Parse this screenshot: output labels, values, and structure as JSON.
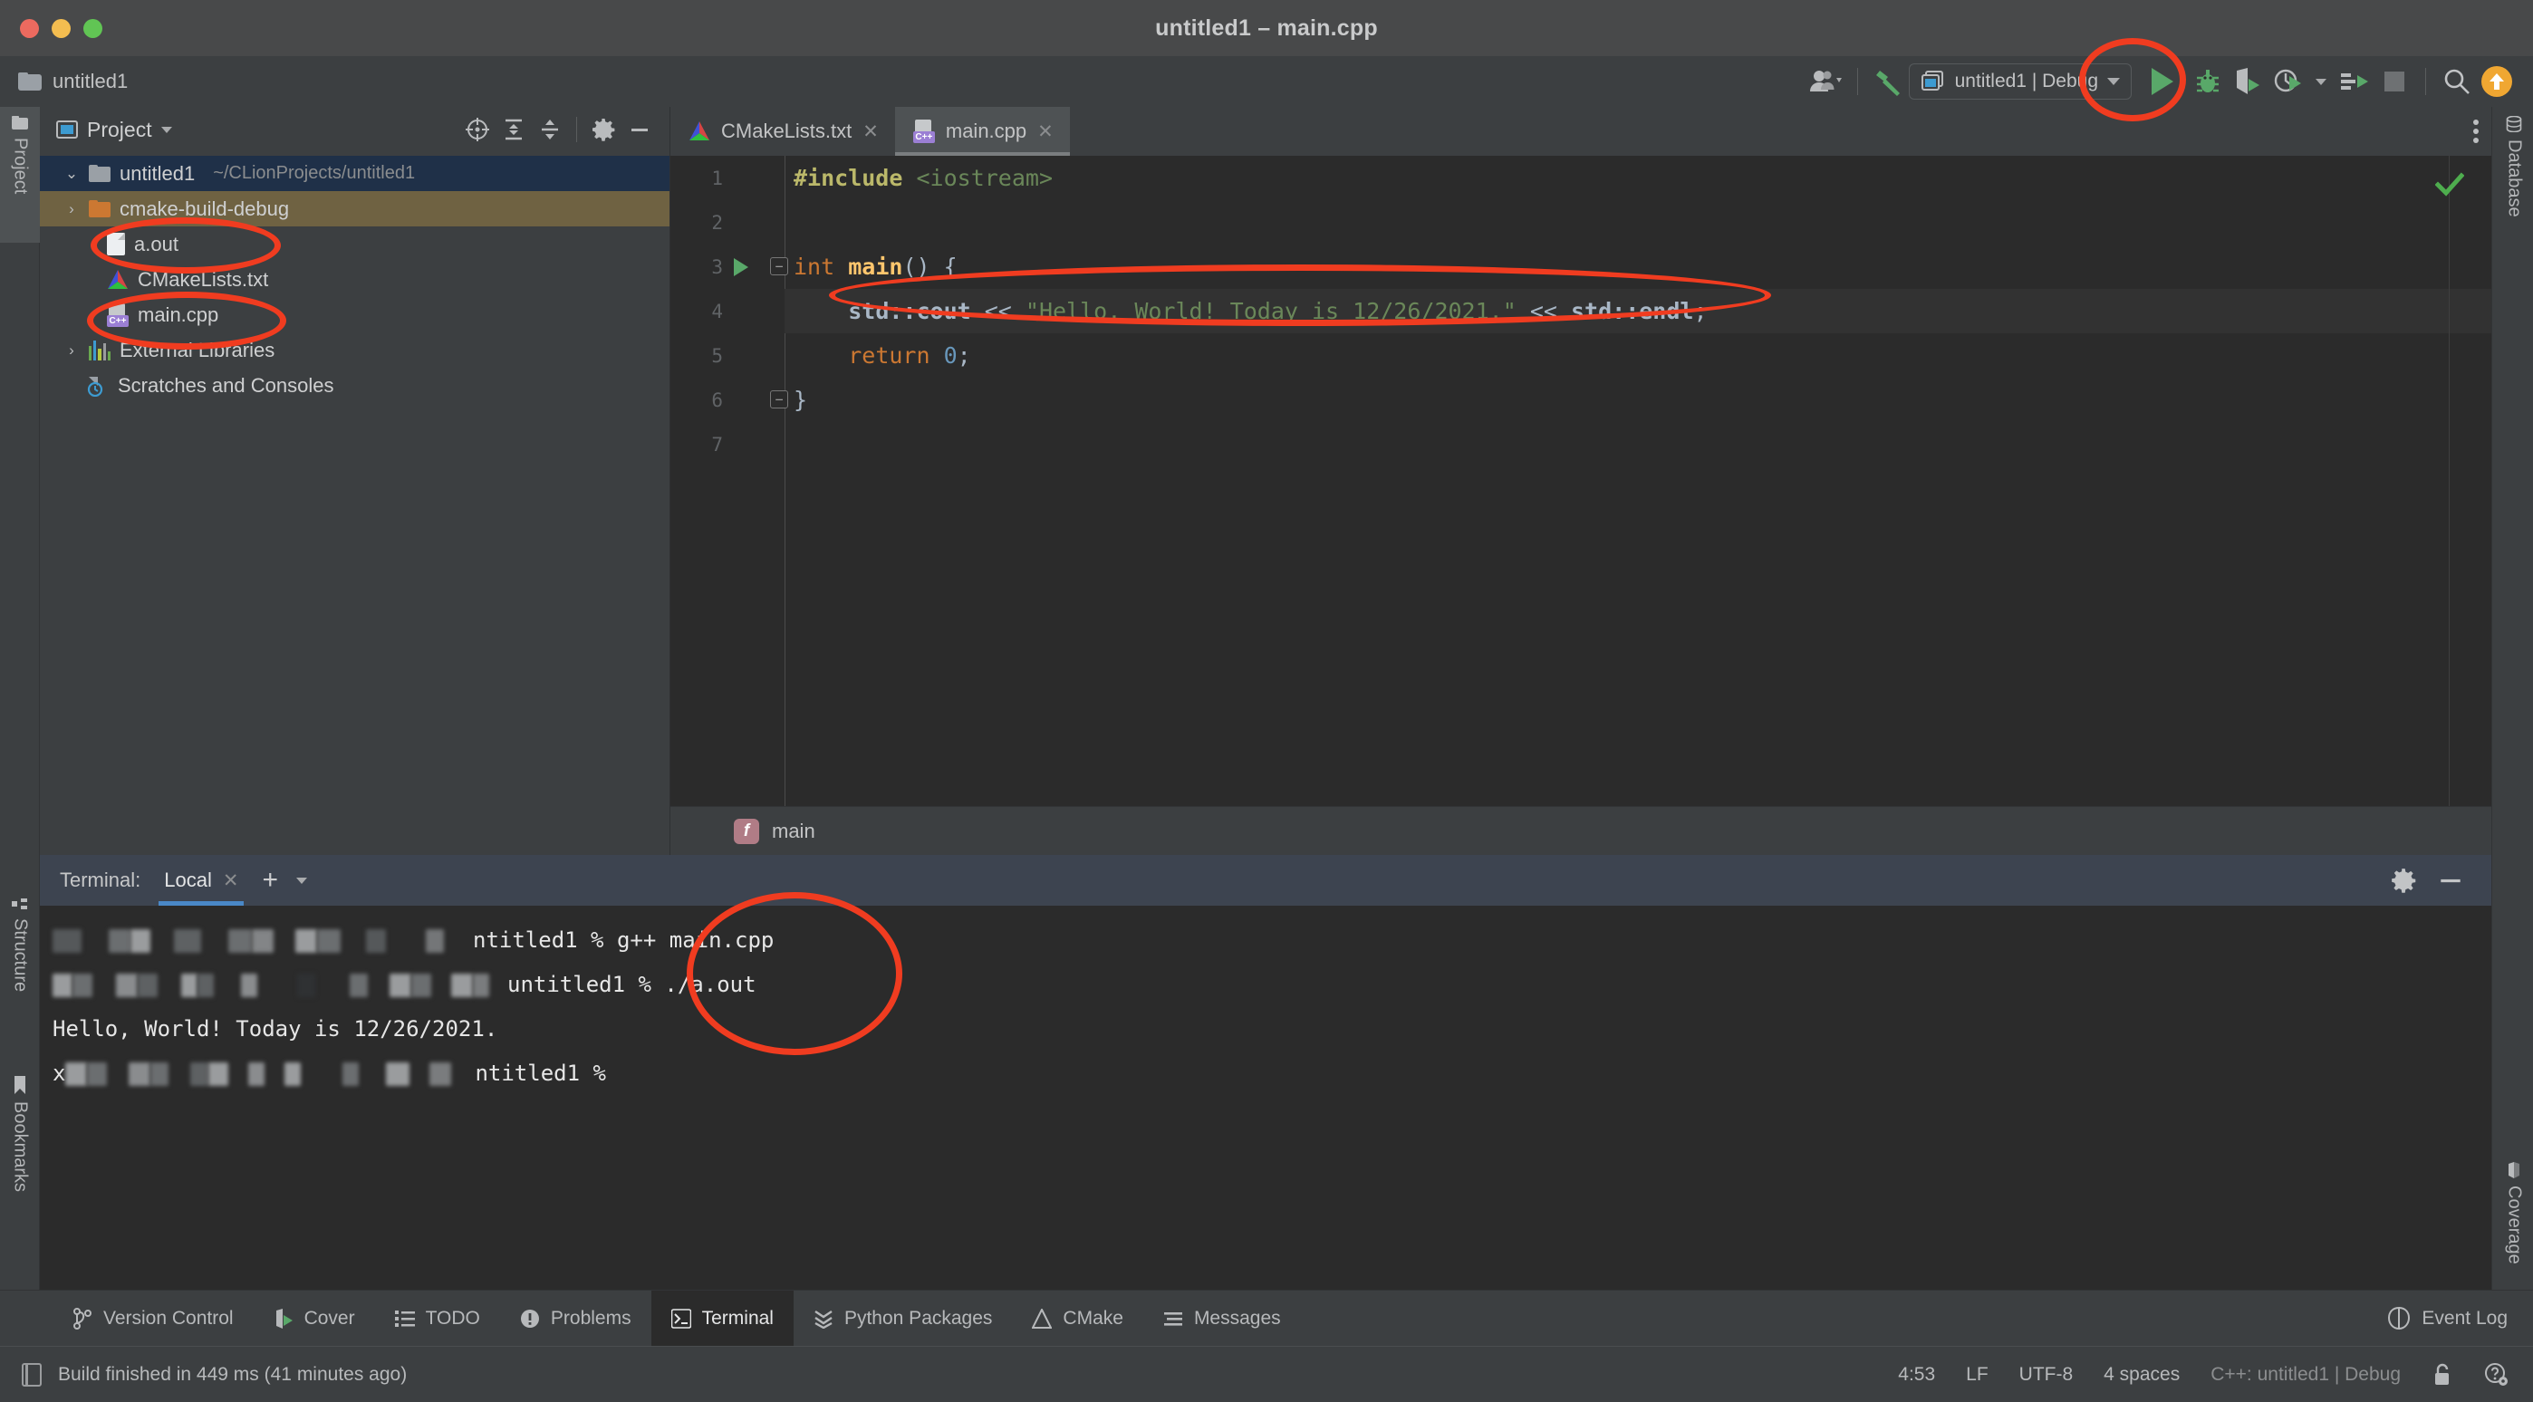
{
  "window": {
    "title": "untitled1 – main.cpp",
    "project_label": "untitled1"
  },
  "toolbar": {
    "run_config": "untitled1 | Debug",
    "icons": {
      "share": "people-share-icon",
      "build": "hammer-build-icon",
      "config": "run-configuration-icon",
      "run": "run-icon",
      "debug": "debug-bug-icon",
      "coverage": "coverage-shield-icon",
      "profile": "profiler-clock-icon",
      "run_with": "run-with-dialog-icon",
      "stop": "stop-icon",
      "search": "search-icon",
      "update": "update-available-icon"
    }
  },
  "left_strip": {
    "tabs": [
      {
        "label": "Project",
        "active": true
      },
      {
        "label": "Structure",
        "active": false
      },
      {
        "label": "Bookmarks",
        "active": false
      }
    ]
  },
  "right_strip": {
    "tabs": [
      {
        "label": "Database",
        "active": false
      },
      {
        "label": "Coverage",
        "active": false
      }
    ]
  },
  "project_panel": {
    "title": "Project",
    "header_icons": [
      "locate-icon",
      "expand-all-icon",
      "collapse-all-icon",
      "gear-icon",
      "minimize-icon"
    ],
    "tree": [
      {
        "label": "untitled1",
        "path": "~/CLionProjects/untitled1",
        "icon": "folder-icon",
        "indent": 0,
        "arrow": "⌄",
        "state": "selected"
      },
      {
        "label": "cmake-build-debug",
        "path": "",
        "icon": "folder-orange-icon",
        "indent": 1,
        "arrow": "›",
        "state": "olive"
      },
      {
        "label": "a.out",
        "path": "",
        "icon": "file-icon",
        "indent": 1,
        "arrow": "",
        "state": "normal"
      },
      {
        "label": "CMakeLists.txt",
        "path": "",
        "icon": "cmake-icon",
        "indent": 1,
        "arrow": "",
        "state": "normal"
      },
      {
        "label": "main.cpp",
        "path": "",
        "icon": "cpp-file-icon",
        "indent": 1,
        "arrow": "",
        "state": "normal"
      },
      {
        "label": "External Libraries",
        "path": "",
        "icon": "library-icon",
        "indent": 0,
        "arrow": "›",
        "state": "normal"
      },
      {
        "label": "Scratches and Consoles",
        "path": "",
        "icon": "scratches-icon",
        "indent": 0,
        "arrow": "",
        "state": "normal"
      }
    ]
  },
  "editor": {
    "tabs": [
      {
        "label": "CMakeLists.txt",
        "icon": "cmake-icon",
        "active": false
      },
      {
        "label": "main.cpp",
        "icon": "cpp-file-icon",
        "active": true
      }
    ],
    "lines": [
      "1",
      "2",
      "3",
      "4",
      "5",
      "6",
      "7"
    ],
    "code": {
      "l1_include": "#include",
      "l1_header": "<iostream>",
      "l3_int": "int",
      "l3_main": "main",
      "l3_tail": "() {",
      "l4_cout": "std::cout",
      "l4_op1": " << ",
      "l4_string": "\"Hello, World! Today is 12/26/2021.\"",
      "l4_op2": " << ",
      "l4_endl": "std::endl",
      "l4_semi": ";",
      "l5_return": "return",
      "l5_zero": "0",
      "l5_semi": ";",
      "l6_brace": "}"
    },
    "breadcrumb": {
      "icon_letter": "f",
      "label": "main"
    },
    "inspection_status": "ok-check-icon"
  },
  "terminal": {
    "label": "Terminal:",
    "tab": "Local",
    "lines": [
      {
        "type": "command",
        "prompt": "ntitled1 % ",
        "text": "g++ main.cpp",
        "redacted": true
      },
      {
        "type": "command",
        "prompt": "untitled1 % ",
        "text": "./a.out",
        "redacted": true
      },
      {
        "type": "output",
        "prompt": "",
        "text": "Hello, World! Today is 12/26/2021.",
        "redacted": false
      },
      {
        "type": "command",
        "prompt": "ntitled1 % ",
        "text": "",
        "redacted": true,
        "prefix": "x"
      }
    ]
  },
  "bottom_tabs": [
    {
      "label": "Version Control",
      "icon": "branch-icon",
      "active": false
    },
    {
      "label": "Cover",
      "icon": "coverage-icon",
      "active": false
    },
    {
      "label": "TODO",
      "icon": "list-icon",
      "active": false
    },
    {
      "label": "Problems",
      "icon": "problem-icon",
      "active": false
    },
    {
      "label": "Terminal",
      "icon": "terminal-icon",
      "active": true
    },
    {
      "label": "Python Packages",
      "icon": "python-packages-icon",
      "active": false
    },
    {
      "label": "CMake",
      "icon": "cmake-icon",
      "active": false
    },
    {
      "label": "Messages",
      "icon": "messages-icon",
      "active": false
    }
  ],
  "event_log": "Event Log",
  "status_bar": {
    "build_message": "Build finished in 449 ms (41 minutes ago)",
    "caret": "4:53",
    "line_sep": "LF",
    "encoding": "UTF-8",
    "indent": "4 spaces",
    "config": "C++: untitled1 | Debug"
  },
  "colors": {
    "accent_run": "#59a869",
    "annotation": "#f03c20",
    "selection": "#1f3048",
    "olive": "#6f6242",
    "terminal_header": "#3d4450",
    "tab_underline": "#4a88c7"
  }
}
